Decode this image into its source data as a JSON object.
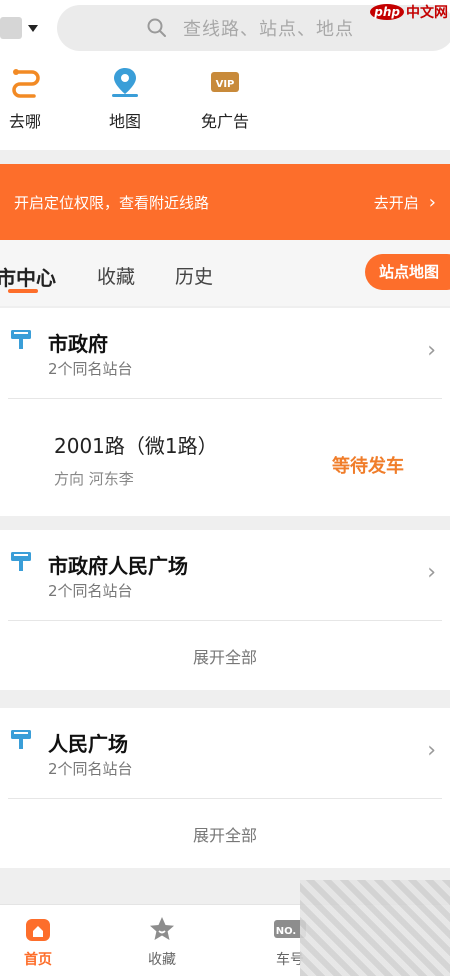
{
  "search": {
    "placeholder": "查线路、站点、地点"
  },
  "watermark": {
    "php": "php",
    "cn": "中文网"
  },
  "quick": [
    {
      "label": "去哪",
      "icon": "route-icon"
    },
    {
      "label": "地图",
      "icon": "map-pin-icon"
    },
    {
      "label": "免广告",
      "icon": "vip-icon"
    }
  ],
  "banner": {
    "text": "开启定位权限，查看附近线路",
    "link": "去开启"
  },
  "tabs": [
    "市中心",
    "收藏",
    "历史"
  ],
  "map_button": "站点地图",
  "stops": [
    {
      "name": "市政府",
      "sub": "2个同名站台"
    },
    {
      "name": "市政府人民广场",
      "sub": "2个同名站台"
    },
    {
      "name": "人民广场",
      "sub": "2个同名站台"
    }
  ],
  "route": {
    "name": "2001路（微1路）",
    "direction": "方向 河东李",
    "status": "等待发车"
  },
  "expand_label": "展开全部",
  "nav": [
    {
      "label": "首页",
      "icon": "home-icon"
    },
    {
      "label": "收藏",
      "icon": "star-icon"
    },
    {
      "label": "车号",
      "icon": "bus-number-icon"
    }
  ],
  "colors": {
    "accent": "#fd6e2b",
    "status": "#f07d2a",
    "stop_icon": "#3a9ed8"
  }
}
